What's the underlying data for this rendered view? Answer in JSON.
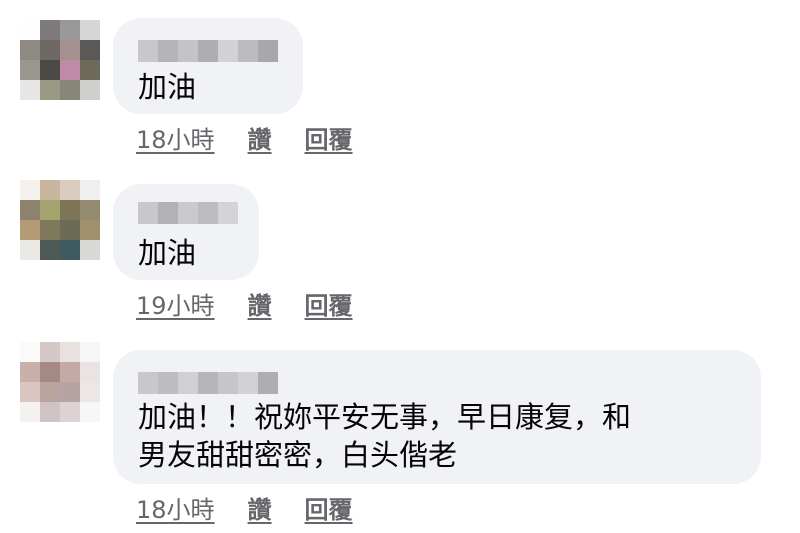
{
  "comments": [
    {
      "text": "加油",
      "time": "18小時",
      "like": "讚",
      "reply": "回覆"
    },
    {
      "text": "加油",
      "time": "19小時",
      "like": "讚",
      "reply": "回覆"
    },
    {
      "text_line1": "加油！！祝妳平安无事，早日康复，和",
      "text_line2": "男友甜甜密密，白头偕老",
      "time": "18小時",
      "like": "讚",
      "reply": "回覆"
    }
  ],
  "colors": {
    "bubble": "#f0f2f5",
    "meta_text": "#65676b",
    "body_text": "#050505"
  }
}
